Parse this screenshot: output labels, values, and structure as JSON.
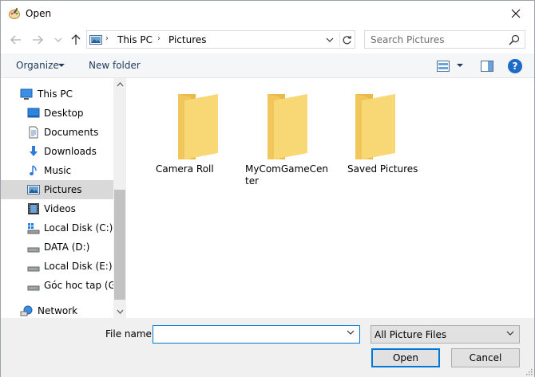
{
  "window": {
    "title": "Open",
    "close_glyph": "✕"
  },
  "nav": {
    "back_glyph": "←",
    "forward_glyph": "→",
    "history_glyph": "⌄",
    "up_glyph": "↑",
    "breadcrumb": [
      "This PC",
      "Pictures"
    ],
    "separator": "›",
    "search_placeholder": "Search Pictures"
  },
  "toolbar": {
    "organize_label": "Organize",
    "new_folder_label": "New folder"
  },
  "sidebar": {
    "items": [
      {
        "label": "This PC",
        "icon": "this-pc-icon",
        "indent": false,
        "selected": false
      },
      {
        "label": "Desktop",
        "icon": "desktop-icon",
        "indent": true,
        "selected": false
      },
      {
        "label": "Documents",
        "icon": "documents-icon",
        "indent": true,
        "selected": false
      },
      {
        "label": "Downloads",
        "icon": "downloads-icon",
        "indent": true,
        "selected": false
      },
      {
        "label": "Music",
        "icon": "music-icon",
        "indent": true,
        "selected": false
      },
      {
        "label": "Pictures",
        "icon": "pictures-icon",
        "indent": true,
        "selected": true
      },
      {
        "label": "Videos",
        "icon": "videos-icon",
        "indent": true,
        "selected": false
      },
      {
        "label": "Local Disk (C:)",
        "icon": "local-disk-c-icon",
        "indent": true,
        "selected": false
      },
      {
        "label": "DATA (D:)",
        "icon": "drive-icon",
        "indent": true,
        "selected": false
      },
      {
        "label": "Local Disk (E:)",
        "icon": "drive-icon",
        "indent": true,
        "selected": false
      },
      {
        "label": "Góc hoc tap (G:)",
        "icon": "drive-icon",
        "indent": true,
        "selected": false
      },
      {
        "label": "Network",
        "icon": "network-icon",
        "indent": false,
        "selected": false
      }
    ]
  },
  "folders": [
    {
      "label": "Camera Roll"
    },
    {
      "label": "MyComGameCenter"
    },
    {
      "label": "Saved Pictures"
    }
  ],
  "bottom": {
    "file_name_label": "File name:",
    "file_name_value": "",
    "file_type": "All Picture Files",
    "open_label": "Open",
    "cancel_label": "Cancel"
  },
  "colors": {
    "accent": "#0078d7",
    "selected_bg": "#d9d9d9",
    "folder": "#f8d775"
  }
}
